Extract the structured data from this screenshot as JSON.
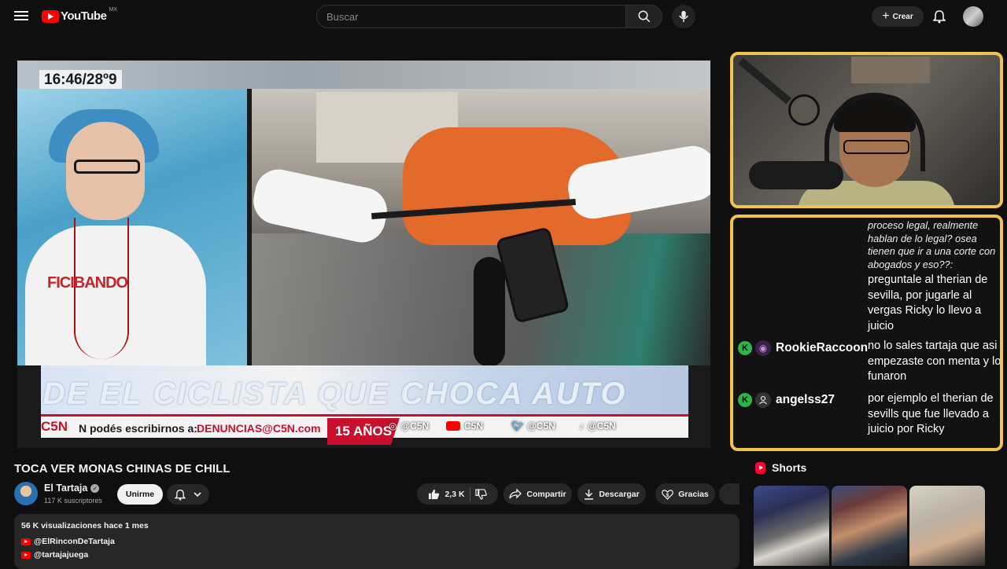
{
  "header": {
    "logo_text": "YouTube",
    "country_code": "MX",
    "search_placeholder": "Buscar",
    "create_label": "Crear"
  },
  "video_frame": {
    "clock": "16:46/28º9",
    "shirt_text": "FICIBANDO",
    "banner_text": "DE EL CICLISTA QUE CHOCA AUTO",
    "ticker_brand": "C5N",
    "ticker_message": "N podés escribirnos a:",
    "ticker_email": "DENUNCIAS@C5N.com",
    "anniversary": "15 AÑOS",
    "social": [
      {
        "icon": "instagram-icon",
        "label": "@C5N"
      },
      {
        "icon": "youtube-icon",
        "label": "C5N"
      },
      {
        "icon": "twitter-icon",
        "label": "@C5N"
      },
      {
        "icon": "tiktok-icon",
        "label": "@C5N"
      }
    ]
  },
  "chat": {
    "messages": [
      {
        "user": "",
        "text": "proceso legal, realmente hablan de lo legal? osea tienen que ir a una corte con abogados y eso??:",
        "style": "italic"
      },
      {
        "user": "",
        "text": "preguntale al therian de sevilla, por jugarle al vergas Ricky lo llevo a juicio",
        "style": "normal"
      },
      {
        "user": "RookieRaccoon",
        "text": "no lo sales tartaja que asi empezaste con menta y lo funaron",
        "style": "normal"
      },
      {
        "user": "angelss27",
        "text": "por ejemplo el therian de sevills que fue llevado a juicio por Ricky",
        "style": "normal"
      }
    ],
    "mod_badge": "K"
  },
  "video_info": {
    "title": "TOCA VER MONAS CHINAS DE CHILL",
    "channel_name": "El Tartaja",
    "subscribers": "117 K suscriptores",
    "join_label": "Unirme",
    "like_count": "2,3 K",
    "share_label": "Compartir",
    "download_label": "Descargar",
    "thanks_label": "Gracias"
  },
  "description": {
    "stats": "56 K visualizaciones  hace 1 mes",
    "links": [
      "@ElRinconDeTartaja",
      "@tartajajuega"
    ]
  },
  "shorts": {
    "heading": "Shorts"
  },
  "colors": {
    "background": "#0f0f0f",
    "overlay_border": "#f0c34a",
    "brand_red": "#ff0000",
    "mod_green": "#2db34a"
  }
}
